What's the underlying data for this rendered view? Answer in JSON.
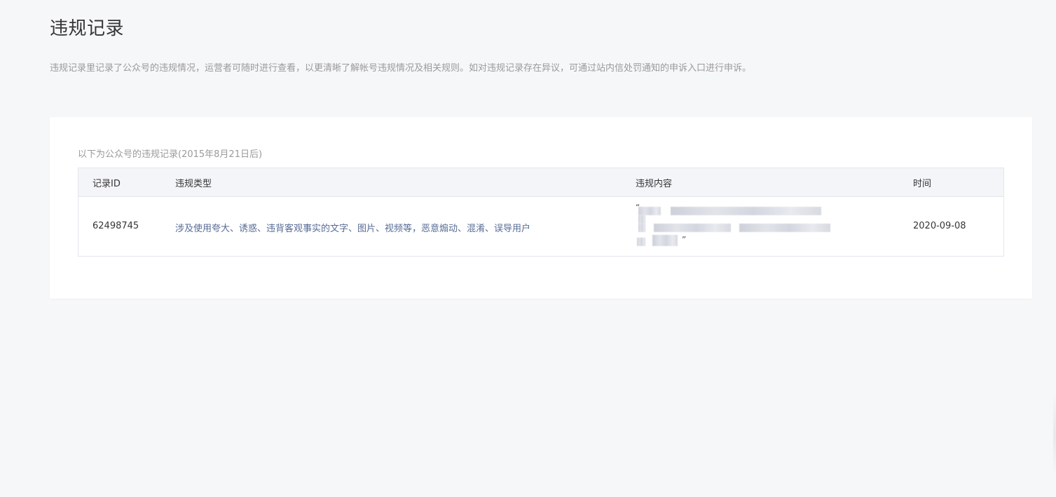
{
  "page": {
    "title": "违规记录",
    "description": "违规记录里记录了公众号的违规情况，运营者可随时进行查看，以更清晰了解帐号违规情况及相关规则。如对违规记录存在异议，可通过站内信处罚通知的申诉入口进行申诉。"
  },
  "records": {
    "caption": "以下为公众号的违规记录(2015年8月21日后)",
    "columns": {
      "id": "记录ID",
      "type": "违规类型",
      "content": "违规内容",
      "time": "时间"
    },
    "rows": [
      {
        "id": "62498745",
        "type": "涉及使用夸大、诱惑、违背客观事实的文字、图片、视频等，恶意煽动、混淆、误导用户",
        "content_open_quote": "“",
        "content_close_quote": "”",
        "time": "2020-09-08"
      }
    ]
  },
  "colors": {
    "background": "#f6f7f9",
    "card": "#ffffff",
    "link": "#576b95",
    "header_bg": "#f4f5f9"
  }
}
